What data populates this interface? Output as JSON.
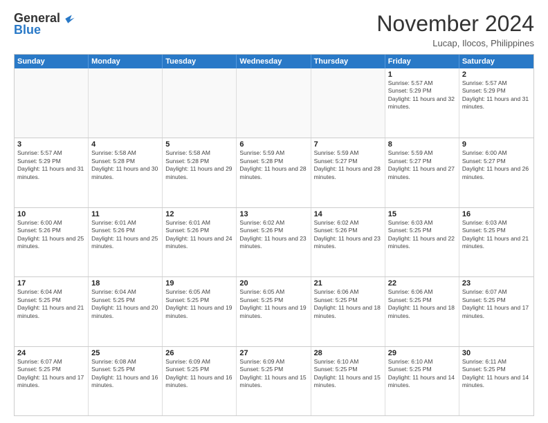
{
  "logo": {
    "general": "General",
    "blue": "Blue"
  },
  "header": {
    "month": "November 2024",
    "location": "Lucap, Ilocos, Philippines"
  },
  "days_of_week": [
    "Sunday",
    "Monday",
    "Tuesday",
    "Wednesday",
    "Thursday",
    "Friday",
    "Saturday"
  ],
  "rows": [
    [
      {
        "day": "",
        "info": ""
      },
      {
        "day": "",
        "info": ""
      },
      {
        "day": "",
        "info": ""
      },
      {
        "day": "",
        "info": ""
      },
      {
        "day": "",
        "info": ""
      },
      {
        "day": "1",
        "info": "Sunrise: 5:57 AM\nSunset: 5:29 PM\nDaylight: 11 hours and 32 minutes."
      },
      {
        "day": "2",
        "info": "Sunrise: 5:57 AM\nSunset: 5:29 PM\nDaylight: 11 hours and 31 minutes."
      }
    ],
    [
      {
        "day": "3",
        "info": "Sunrise: 5:57 AM\nSunset: 5:29 PM\nDaylight: 11 hours and 31 minutes."
      },
      {
        "day": "4",
        "info": "Sunrise: 5:58 AM\nSunset: 5:28 PM\nDaylight: 11 hours and 30 minutes."
      },
      {
        "day": "5",
        "info": "Sunrise: 5:58 AM\nSunset: 5:28 PM\nDaylight: 11 hours and 29 minutes."
      },
      {
        "day": "6",
        "info": "Sunrise: 5:59 AM\nSunset: 5:28 PM\nDaylight: 11 hours and 28 minutes."
      },
      {
        "day": "7",
        "info": "Sunrise: 5:59 AM\nSunset: 5:27 PM\nDaylight: 11 hours and 28 minutes."
      },
      {
        "day": "8",
        "info": "Sunrise: 5:59 AM\nSunset: 5:27 PM\nDaylight: 11 hours and 27 minutes."
      },
      {
        "day": "9",
        "info": "Sunrise: 6:00 AM\nSunset: 5:27 PM\nDaylight: 11 hours and 26 minutes."
      }
    ],
    [
      {
        "day": "10",
        "info": "Sunrise: 6:00 AM\nSunset: 5:26 PM\nDaylight: 11 hours and 25 minutes."
      },
      {
        "day": "11",
        "info": "Sunrise: 6:01 AM\nSunset: 5:26 PM\nDaylight: 11 hours and 25 minutes."
      },
      {
        "day": "12",
        "info": "Sunrise: 6:01 AM\nSunset: 5:26 PM\nDaylight: 11 hours and 24 minutes."
      },
      {
        "day": "13",
        "info": "Sunrise: 6:02 AM\nSunset: 5:26 PM\nDaylight: 11 hours and 23 minutes."
      },
      {
        "day": "14",
        "info": "Sunrise: 6:02 AM\nSunset: 5:26 PM\nDaylight: 11 hours and 23 minutes."
      },
      {
        "day": "15",
        "info": "Sunrise: 6:03 AM\nSunset: 5:25 PM\nDaylight: 11 hours and 22 minutes."
      },
      {
        "day": "16",
        "info": "Sunrise: 6:03 AM\nSunset: 5:25 PM\nDaylight: 11 hours and 21 minutes."
      }
    ],
    [
      {
        "day": "17",
        "info": "Sunrise: 6:04 AM\nSunset: 5:25 PM\nDaylight: 11 hours and 21 minutes."
      },
      {
        "day": "18",
        "info": "Sunrise: 6:04 AM\nSunset: 5:25 PM\nDaylight: 11 hours and 20 minutes."
      },
      {
        "day": "19",
        "info": "Sunrise: 6:05 AM\nSunset: 5:25 PM\nDaylight: 11 hours and 19 minutes."
      },
      {
        "day": "20",
        "info": "Sunrise: 6:05 AM\nSunset: 5:25 PM\nDaylight: 11 hours and 19 minutes."
      },
      {
        "day": "21",
        "info": "Sunrise: 6:06 AM\nSunset: 5:25 PM\nDaylight: 11 hours and 18 minutes."
      },
      {
        "day": "22",
        "info": "Sunrise: 6:06 AM\nSunset: 5:25 PM\nDaylight: 11 hours and 18 minutes."
      },
      {
        "day": "23",
        "info": "Sunrise: 6:07 AM\nSunset: 5:25 PM\nDaylight: 11 hours and 17 minutes."
      }
    ],
    [
      {
        "day": "24",
        "info": "Sunrise: 6:07 AM\nSunset: 5:25 PM\nDaylight: 11 hours and 17 minutes."
      },
      {
        "day": "25",
        "info": "Sunrise: 6:08 AM\nSunset: 5:25 PM\nDaylight: 11 hours and 16 minutes."
      },
      {
        "day": "26",
        "info": "Sunrise: 6:09 AM\nSunset: 5:25 PM\nDaylight: 11 hours and 16 minutes."
      },
      {
        "day": "27",
        "info": "Sunrise: 6:09 AM\nSunset: 5:25 PM\nDaylight: 11 hours and 15 minutes."
      },
      {
        "day": "28",
        "info": "Sunrise: 6:10 AM\nSunset: 5:25 PM\nDaylight: 11 hours and 15 minutes."
      },
      {
        "day": "29",
        "info": "Sunrise: 6:10 AM\nSunset: 5:25 PM\nDaylight: 11 hours and 14 minutes."
      },
      {
        "day": "30",
        "info": "Sunrise: 6:11 AM\nSunset: 5:25 PM\nDaylight: 11 hours and 14 minutes."
      }
    ]
  ]
}
